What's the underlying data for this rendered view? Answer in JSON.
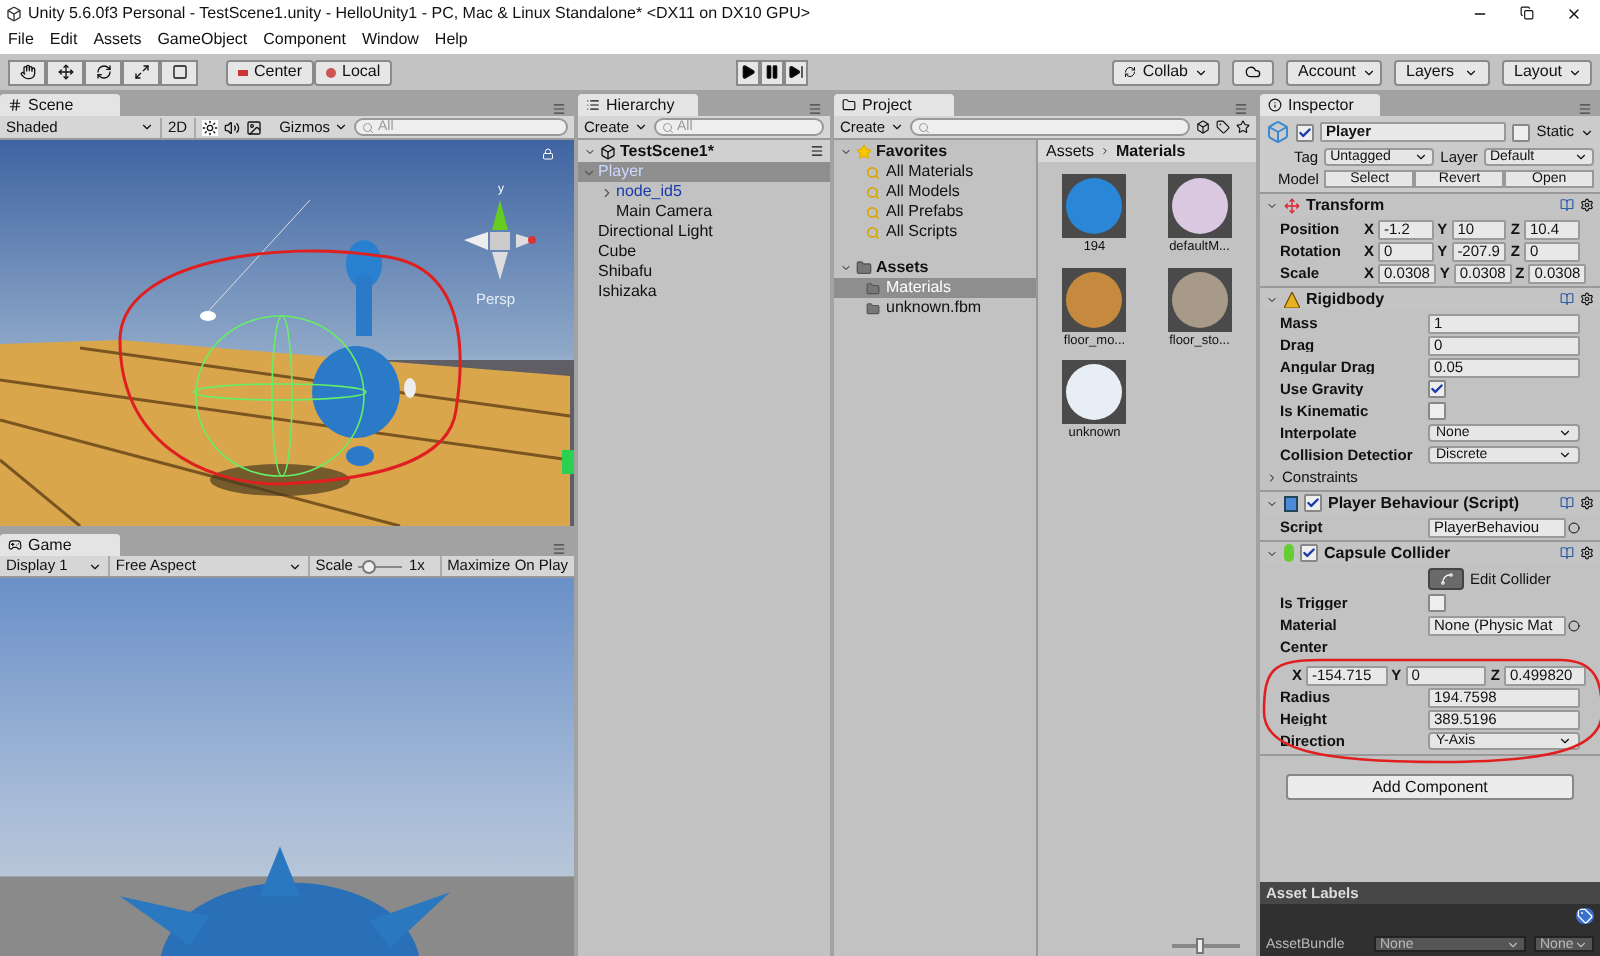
{
  "window": {
    "title": "Unity 5.6.0f3 Personal - TestScene1.unity - HelloUnity1 - PC, Mac & Linux Standalone* <DX11 on DX10 GPU>"
  },
  "menu": [
    "File",
    "Edit",
    "Assets",
    "GameObject",
    "Component",
    "Window",
    "Help"
  ],
  "toolbar": {
    "pivot": [
      "Center",
      "Local"
    ],
    "collab": "Collab",
    "account": "Account",
    "layers": "Layers",
    "layout": "Layout"
  },
  "scene": {
    "tab": "Scene",
    "shading": "Shaded",
    "toggle_2d": "2D",
    "gizmos": "Gizmos",
    "search_placeholder": "All",
    "axis_label": "y",
    "projection": "Persp"
  },
  "game": {
    "tab": "Game",
    "display": "Display 1",
    "aspect": "Free Aspect",
    "scale_label": "Scale",
    "scale_value": "1x",
    "scale_slider": {
      "level": 0.1
    },
    "maximize": "Maximize On Play"
  },
  "hierarchy": {
    "tab": "Hierarchy",
    "create": "Create",
    "search_placeholder": "All",
    "scene": "TestScene1*",
    "items": [
      {
        "label": "Player",
        "selected": true,
        "prefab": true,
        "expanded": true,
        "children": [
          {
            "label": "node_id5",
            "selected": false,
            "prefab": true,
            "expanded": false
          },
          {
            "label": "Main Camera",
            "selected": false,
            "prefab": false
          }
        ]
      },
      {
        "label": "Directional Light",
        "selected": false,
        "prefab": false
      },
      {
        "label": "Cube",
        "selected": false,
        "prefab": false
      },
      {
        "label": "Shibafu",
        "selected": false,
        "prefab": false
      },
      {
        "label": "Ishizaka",
        "selected": false,
        "prefab": false
      }
    ]
  },
  "project": {
    "tab": "Project",
    "create": "Create",
    "favorites": {
      "label": "Favorites",
      "items": [
        "All Materials",
        "All Models",
        "All Prefabs",
        "All Scripts"
      ]
    },
    "assets": {
      "label": "Assets",
      "items": [
        {
          "label": "Materials",
          "selected": true
        },
        {
          "label": "unknown.fbm",
          "selected": false
        }
      ]
    },
    "breadcrumb": [
      "Assets",
      "Materials"
    ],
    "materials": [
      {
        "name": "194",
        "color": "#2a86d6"
      },
      {
        "name": "defaultM...",
        "color": "#d9c8e0"
      },
      {
        "name": "floor_mo...",
        "color": "#c68a3e"
      },
      {
        "name": "floor_sto...",
        "color": "#a89a88"
      },
      {
        "name": "unknown",
        "color": "#e8eef6"
      }
    ],
    "size_slider": {
      "level": 0.4
    }
  },
  "inspector": {
    "tab": "Inspector",
    "name": "Player",
    "active": true,
    "static_label": "Static",
    "static": false,
    "tag_label": "Tag",
    "tag": "Untagged",
    "layer_label": "Layer",
    "layer": "Default",
    "model_label": "Model",
    "model_buttons": [
      "Select",
      "Revert",
      "Open"
    ],
    "components": [
      {
        "kind": "transform",
        "title": "Transform",
        "expanded": true,
        "rows": [
          {
            "label": "Position",
            "values": [
              {
                "axis": "X",
                "value": "-1.2"
              },
              {
                "axis": "Y",
                "value": "10"
              },
              {
                "axis": "Z",
                "value": "10.4"
              }
            ]
          },
          {
            "label": "Rotation",
            "values": [
              {
                "axis": "X",
                "value": "0"
              },
              {
                "axis": "Y",
                "value": "-207.9"
              },
              {
                "axis": "Z",
                "value": "0"
              }
            ]
          },
          {
            "label": "Scale",
            "values": [
              {
                "axis": "X",
                "value": "0.0308"
              },
              {
                "axis": "Y",
                "value": "0.0308"
              },
              {
                "axis": "Z",
                "value": "0.0308"
              }
            ]
          }
        ]
      },
      {
        "kind": "rigidbody",
        "title": "Rigidbody",
        "expanded": true,
        "props": [
          {
            "kind": "text",
            "label": "Mass",
            "value": "1"
          },
          {
            "kind": "text",
            "label": "Drag",
            "value": "0"
          },
          {
            "kind": "text",
            "label": "Angular Drag",
            "value": "0.05"
          },
          {
            "kind": "check",
            "label": "Use Gravity",
            "checked": true
          },
          {
            "kind": "check",
            "label": "Is Kinematic",
            "checked": false
          },
          {
            "kind": "dropdown",
            "label": "Interpolate",
            "value": "None"
          },
          {
            "kind": "dropdown",
            "label": "Collision Detectior",
            "value": "Discrete"
          },
          {
            "kind": "foldout",
            "label": "Constraints",
            "expanded": false
          }
        ]
      },
      {
        "kind": "script",
        "title": "Player Behaviour (Script)",
        "expanded": true,
        "enabled": true,
        "props": [
          {
            "kind": "object",
            "label": "Script",
            "value": "PlayerBehaviou"
          }
        ]
      },
      {
        "kind": "capsule",
        "title": "Capsule Collider",
        "expanded": true,
        "enabled": true,
        "props": [
          {
            "kind": "button",
            "label": "Edit Collider"
          },
          {
            "kind": "check",
            "label": "Is Trigger",
            "checked": false
          },
          {
            "kind": "object",
            "label": "Material",
            "value": "None (Physic Mat"
          },
          {
            "kind": "vector",
            "label": "Center",
            "values": [
              {
                "axis": "X",
                "value": "-154.715"
              },
              {
                "axis": "Y",
                "value": "0"
              },
              {
                "axis": "Z",
                "value": "0.499820"
              }
            ]
          },
          {
            "kind": "text",
            "label": "Radius",
            "value": "194.7598"
          },
          {
            "kind": "text",
            "label": "Height",
            "value": "389.5196"
          },
          {
            "kind": "dropdown",
            "label": "Direction",
            "value": "Y-Axis"
          }
        ]
      }
    ],
    "add_component": "Add Component",
    "asset_labels": {
      "title": "Asset Labels",
      "bundle_label": "AssetBundle",
      "bundle": "None",
      "variant": "None"
    }
  }
}
